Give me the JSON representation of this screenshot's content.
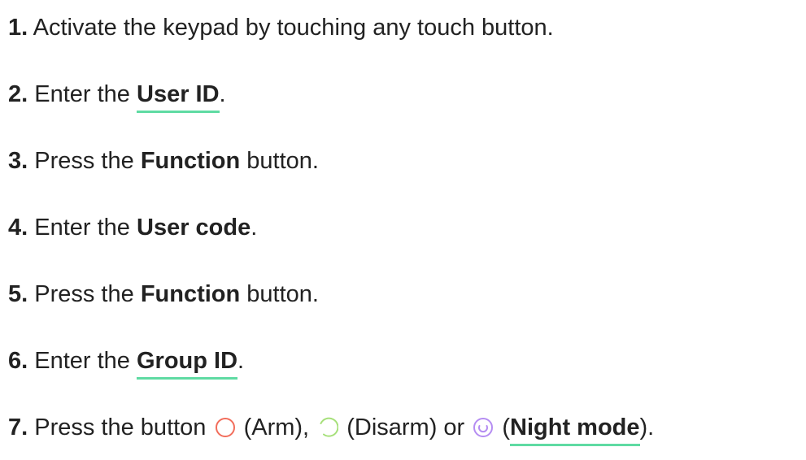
{
  "steps": [
    {
      "number": "1.",
      "text": "Activate the keypad by touching any touch button."
    },
    {
      "number": "2.",
      "before": "Enter the ",
      "link": "User ID",
      "after": "."
    },
    {
      "number": "3.",
      "before": "Press the ",
      "bold": "Function",
      "after": " button."
    },
    {
      "number": "4.",
      "before": "Enter the ",
      "bold": "User code",
      "after": "."
    },
    {
      "number": "5.",
      "before": "Press the ",
      "bold": "Function",
      "after": " button."
    },
    {
      "number": "6.",
      "before": "Enter the ",
      "link": "Group ID",
      "after": "."
    },
    {
      "number": "7.",
      "before": "Press the button ",
      "arm_label": "(Arm),",
      "disarm_label": "(Disarm) or",
      "open_paren": "(",
      "night_mode_link": "Night mode",
      "close": ")."
    }
  ],
  "icons": {
    "arm": {
      "name": "arm-icon",
      "color": "#f26d5b"
    },
    "disarm": {
      "name": "disarm-icon",
      "color": "#a6e07a"
    },
    "night": {
      "name": "night-mode-icon",
      "color": "#b58df2"
    }
  },
  "colors": {
    "text": "#222222",
    "link_underline": "#5fdba3"
  }
}
